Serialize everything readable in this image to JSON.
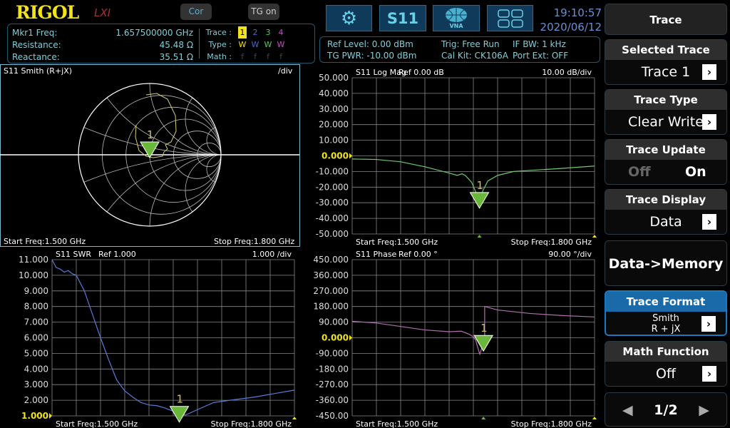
{
  "header": {
    "logo": "RIGOL",
    "lxi": "LXI",
    "cor": "Cor",
    "tg": "TG on",
    "s11": "S11",
    "vna": "VNA",
    "time": "19:10:57",
    "date": "2020/06/12"
  },
  "marker": {
    "freq_label": "Mkr1 Freq:",
    "freq": "1.657500000 GHz",
    "res_label": "Resistance:",
    "res": "45.48 Ω",
    "react_label": "Reactance:",
    "react": "35.51 Ω"
  },
  "traces": {
    "trace_label": "Trace :",
    "type_label": "Type :",
    "math_label": "Math :",
    "nums": [
      "1",
      "2",
      "3",
      "4"
    ],
    "types": [
      "W",
      "W",
      "W",
      "W"
    ],
    "maths": [
      "f",
      "f",
      "f",
      "f"
    ],
    "colors": [
      "#f2e21a",
      "#4a6ad0",
      "#5ac85a",
      "#c050c0"
    ]
  },
  "status": {
    "ref": "Ref Level: 0.00 dBm",
    "tg": "TG PWR: -10.00 dBm",
    "trig": "Trig: Free Run",
    "cal": "Cal Kit: CK106A",
    "ifbw": "IF BW: 1 kHz",
    "port": "Port Ext: OFF"
  },
  "menu": {
    "title": "Trace",
    "selected_trace": {
      "label": "Selected Trace",
      "value": "Trace 1"
    },
    "trace_type": {
      "label": "Trace Type",
      "value": "Clear Write"
    },
    "trace_update": {
      "label": "Trace Update",
      "off": "Off",
      "on": "On"
    },
    "trace_display": {
      "label": "Trace Display",
      "value": "Data"
    },
    "data_memory": "Data->Memory",
    "trace_format": {
      "label": "Trace Format",
      "value1": "Smith",
      "value2": "R + jX"
    },
    "math_function": {
      "label": "Math Function",
      "value": "Off"
    },
    "page": "1/2"
  },
  "chart_data": [
    {
      "type": "smith",
      "title": "S11  Smith (R+jX)",
      "scale": "/div",
      "start": "Start Freq:1.500 GHz",
      "stop": "Stop Freq:1.800 GHz",
      "color": "#d8d070",
      "marker": "1",
      "marker_gamma": [
        0.0,
        0.02
      ],
      "gamma": [
        [
          -0.05,
          0.84
        ],
        [
          0.1,
          0.86
        ],
        [
          0.25,
          0.78
        ],
        [
          0.36,
          0.55
        ],
        [
          0.37,
          0.33
        ],
        [
          0.3,
          0.18
        ],
        [
          0.22,
          0.14
        ],
        [
          0.25,
          0.08
        ],
        [
          0.2,
          0.04
        ],
        [
          0.18,
          -0.02
        ],
        [
          0.05,
          -0.04
        ],
        [
          -0.05,
          -0.02
        ],
        [
          -0.15,
          0.06
        ],
        [
          -0.2,
          0.25
        ],
        [
          -0.19,
          0.42
        ]
      ]
    },
    {
      "type": "line",
      "title": "S11  Log Mag",
      "ref": "Ref 0.00 dB",
      "scale": "10.00  dB/div",
      "start": "Start Freq:1.500 GHz",
      "stop": "Stop Freq:1.800 GHz",
      "xlim": [
        1.5,
        1.8
      ],
      "ylim": [
        -50,
        50
      ],
      "ref_tick": "0.000",
      "color": "#6ec86e",
      "marker": "1",
      "marker_x": 1.6575,
      "yticks": [
        "50.000",
        "40.000",
        "30.000",
        "20.000",
        "10.000",
        "0.000",
        "-10.000",
        "-20.000",
        "-30.000",
        "-40.000",
        "-50.000"
      ],
      "x": [
        1.5,
        1.53,
        1.56,
        1.59,
        1.62,
        1.63,
        1.636,
        1.64,
        1.648,
        1.652,
        1.6575,
        1.662,
        1.668,
        1.68,
        1.7,
        1.73,
        1.76,
        1.8
      ],
      "y": [
        -2,
        -2.3,
        -3.8,
        -7,
        -11,
        -12.5,
        -11.5,
        -12.5,
        -17,
        -22,
        -28,
        -22,
        -16,
        -12.5,
        -10,
        -9,
        -8,
        -6.5
      ]
    },
    {
      "type": "line",
      "title": "S11  SWR",
      "ref": "Ref 1.000",
      "scale": "1.000  /div",
      "start": "Start Freq:1.500 GHz",
      "stop": "Stop Freq:1.800 GHz",
      "xlim": [
        1.5,
        1.8
      ],
      "ylim": [
        1,
        11
      ],
      "ref_tick": "1.000",
      "color": "#5a7ad8",
      "marker": "1",
      "marker_x": 1.6575,
      "yticks": [
        "11.000",
        "10.000",
        "9.000",
        "8.000",
        "7.000",
        "6.000",
        "5.000",
        "4.000",
        "3.000",
        "2.000",
        "1.000"
      ],
      "x": [
        1.5,
        1.505,
        1.51,
        1.515,
        1.52,
        1.525,
        1.53,
        1.54,
        1.55,
        1.56,
        1.57,
        1.58,
        1.59,
        1.6,
        1.61,
        1.62,
        1.63,
        1.64,
        1.65,
        1.6575,
        1.665,
        1.68,
        1.7,
        1.72,
        1.75,
        1.8
      ],
      "y": [
        11,
        10.5,
        10.4,
        10.2,
        10.3,
        10.1,
        10,
        9,
        7.5,
        6,
        4.6,
        3.3,
        2.6,
        2.2,
        1.85,
        1.7,
        1.65,
        1.5,
        1.3,
        1.15,
        1.05,
        1.4,
        1.85,
        2.0,
        2.2,
        2.65
      ]
    },
    {
      "type": "line",
      "title": "S11  Phase",
      "ref": "Ref 0.00 °",
      "scale": "90.00  °/div",
      "start": "Start Freq:1.500 GHz",
      "stop": "Stop Freq:1.800 GHz",
      "xlim": [
        1.5,
        1.8
      ],
      "ylim": [
        -450,
        450
      ],
      "ref_tick": "0.000",
      "color": "#b070b0",
      "marker": "1",
      "marker_x": 1.6625,
      "yticks": [
        "450.000",
        "360.000",
        "270.000",
        "180.000",
        "90.000",
        "0.000",
        "-90.000",
        "-180.00",
        "-270.00",
        "-360.00",
        "-450.00"
      ],
      "x": [
        1.5,
        1.53,
        1.56,
        1.59,
        1.62,
        1.635,
        1.645,
        1.65,
        1.653,
        1.655,
        1.658,
        1.664,
        1.664,
        1.68,
        1.72,
        1.76,
        1.8
      ],
      "y": [
        95,
        85,
        65,
        45,
        35,
        38,
        20,
        5,
        -15,
        -50,
        -95,
        -5,
        180,
        160,
        140,
        128,
        120
      ]
    }
  ]
}
